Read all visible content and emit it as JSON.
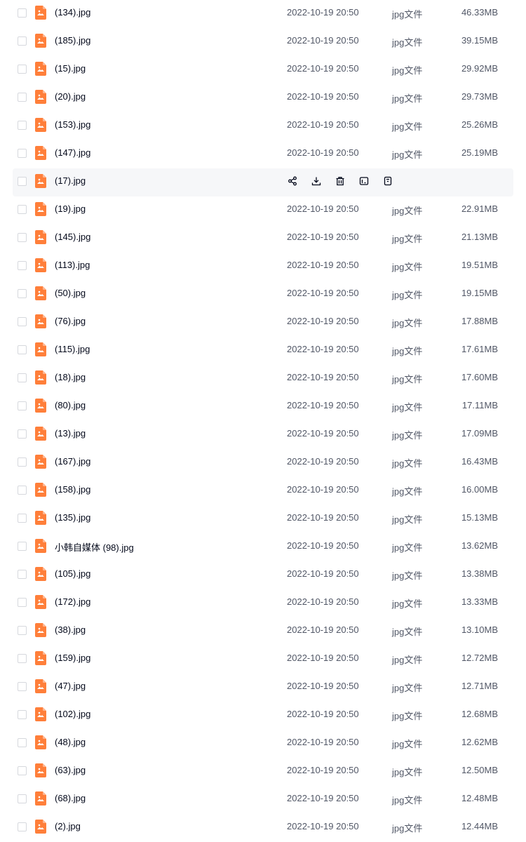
{
  "files": [
    {
      "name": "(134).jpg",
      "date": "2022-10-19 20:50",
      "type": "jpg文件",
      "size": "46.33MB"
    },
    {
      "name": "(185).jpg",
      "date": "2022-10-19 20:50",
      "type": "jpg文件",
      "size": "39.15MB"
    },
    {
      "name": "(15).jpg",
      "date": "2022-10-19 20:50",
      "type": "jpg文件",
      "size": "29.92MB"
    },
    {
      "name": "(20).jpg",
      "date": "2022-10-19 20:50",
      "type": "jpg文件",
      "size": "29.73MB"
    },
    {
      "name": "(153).jpg",
      "date": "2022-10-19 20:50",
      "type": "jpg文件",
      "size": "25.26MB"
    },
    {
      "name": "(147).jpg",
      "date": "2022-10-19 20:50",
      "type": "jpg文件",
      "size": "25.19MB"
    },
    {
      "name": "(17).jpg",
      "hovered": true
    },
    {
      "name": "(19).jpg",
      "date": "2022-10-19 20:50",
      "type": "jpg文件",
      "size": "22.91MB"
    },
    {
      "name": "(145).jpg",
      "date": "2022-10-19 20:50",
      "type": "jpg文件",
      "size": "21.13MB"
    },
    {
      "name": "(113).jpg",
      "date": "2022-10-19 20:50",
      "type": "jpg文件",
      "size": "19.51MB"
    },
    {
      "name": "(50).jpg",
      "date": "2022-10-19 20:50",
      "type": "jpg文件",
      "size": "19.15MB"
    },
    {
      "name": "(76).jpg",
      "date": "2022-10-19 20:50",
      "type": "jpg文件",
      "size": "17.88MB"
    },
    {
      "name": "(115).jpg",
      "date": "2022-10-19 20:50",
      "type": "jpg文件",
      "size": "17.61MB"
    },
    {
      "name": "(18).jpg",
      "date": "2022-10-19 20:50",
      "type": "jpg文件",
      "size": "17.60MB"
    },
    {
      "name": "(80).jpg",
      "date": "2022-10-19 20:50",
      "type": "jpg文件",
      "size": "17.11MB"
    },
    {
      "name": "(13).jpg",
      "date": "2022-10-19 20:50",
      "type": "jpg文件",
      "size": "17.09MB"
    },
    {
      "name": "(167).jpg",
      "date": "2022-10-19 20:50",
      "type": "jpg文件",
      "size": "16.43MB"
    },
    {
      "name": "(158).jpg",
      "date": "2022-10-19 20:50",
      "type": "jpg文件",
      "size": "16.00MB"
    },
    {
      "name": "(135).jpg",
      "date": "2022-10-19 20:50",
      "type": "jpg文件",
      "size": "15.13MB"
    },
    {
      "name": "小韩自媒体 (98).jpg",
      "date": "2022-10-19 20:50",
      "type": "jpg文件",
      "size": "13.62MB"
    },
    {
      "name": "(105).jpg",
      "date": "2022-10-19 20:50",
      "type": "jpg文件",
      "size": "13.38MB"
    },
    {
      "name": "(172).jpg",
      "date": "2022-10-19 20:50",
      "type": "jpg文件",
      "size": "13.33MB"
    },
    {
      "name": "(38).jpg",
      "date": "2022-10-19 20:50",
      "type": "jpg文件",
      "size": "13.10MB"
    },
    {
      "name": "(159).jpg",
      "date": "2022-10-19 20:50",
      "type": "jpg文件",
      "size": "12.72MB"
    },
    {
      "name": "(47).jpg",
      "date": "2022-10-19 20:50",
      "type": "jpg文件",
      "size": "12.71MB"
    },
    {
      "name": "(102).jpg",
      "date": "2022-10-19 20:50",
      "type": "jpg文件",
      "size": "12.68MB"
    },
    {
      "name": "(48).jpg",
      "date": "2022-10-19 20:50",
      "type": "jpg文件",
      "size": "12.62MB"
    },
    {
      "name": "(63).jpg",
      "date": "2022-10-19 20:50",
      "type": "jpg文件",
      "size": "12.50MB"
    },
    {
      "name": "(68).jpg",
      "date": "2022-10-19 20:50",
      "type": "jpg文件",
      "size": "12.48MB"
    },
    {
      "name": "(2).jpg",
      "date": "2022-10-19 20:50",
      "type": "jpg文件",
      "size": "12.44MB"
    }
  ],
  "hover_actions": [
    "share-icon",
    "download-icon",
    "delete-icon",
    "rename-icon",
    "more-icon"
  ],
  "colors": {
    "file_icon": "#ff7f3a",
    "hover_row": "#f6f7f9",
    "action_icon": "#03081a"
  }
}
